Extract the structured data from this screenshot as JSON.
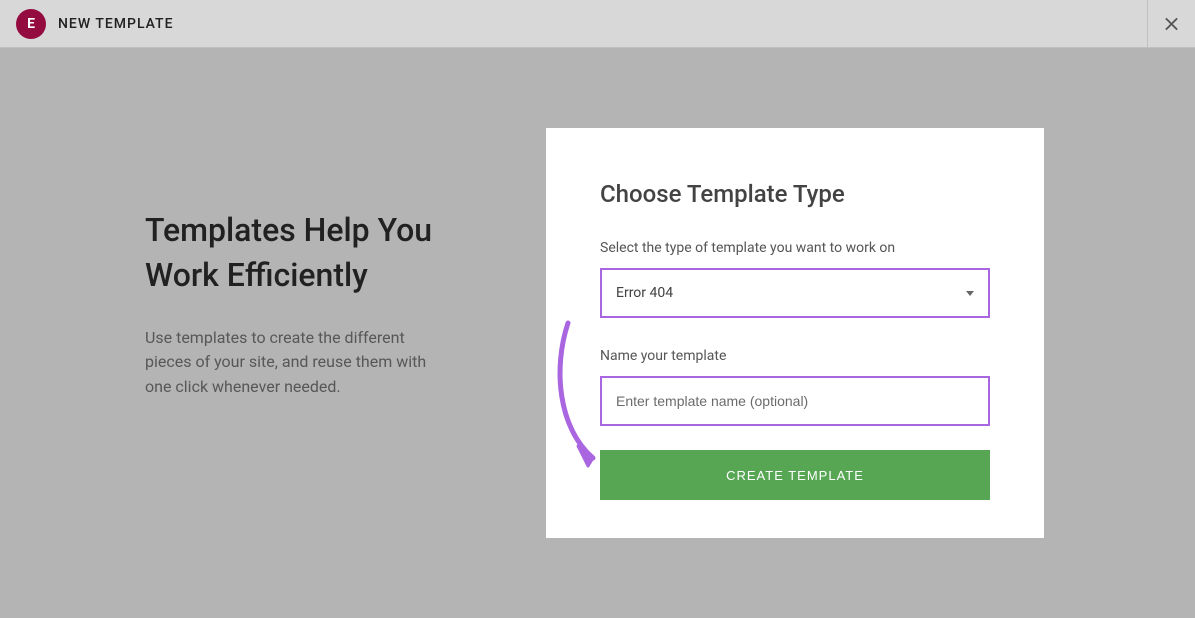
{
  "header": {
    "title": "NEW TEMPLATE"
  },
  "intro": {
    "heading": "Templates Help You Work Efficiently",
    "text": "Use templates to create the different pieces of your site, and reuse them with one click whenever needed."
  },
  "form": {
    "heading": "Choose Template Type",
    "type_label": "Select the type of template you want to work on",
    "type_value": "Error 404",
    "name_label": "Name your template",
    "name_placeholder": "Enter template name (optional)",
    "submit": "CREATE TEMPLATE"
  }
}
